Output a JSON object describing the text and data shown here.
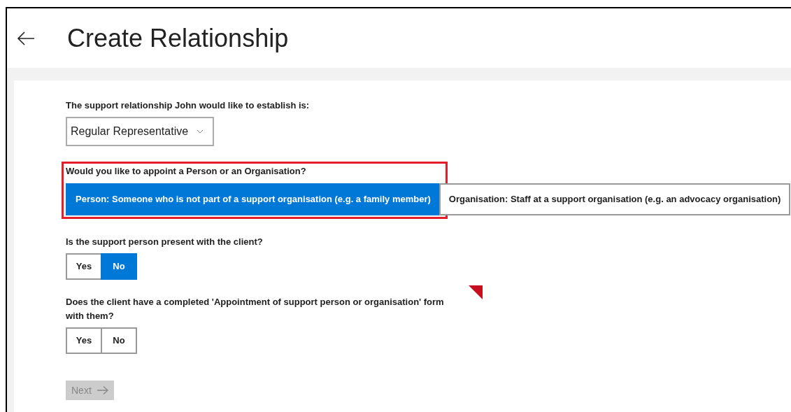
{
  "header": {
    "title": "Create Relationship"
  },
  "relationship": {
    "label": "The support relationship John would like to establish is:",
    "value": "Regular Representative"
  },
  "appoint": {
    "label": "Would you like to appoint a Person or an Organisation?",
    "highlighted": true,
    "options": [
      {
        "label": "Person: Someone who is not part of a support organisation (e.g. a family member)",
        "selected": true
      },
      {
        "label": "Organisation: Staff at a support organisation (e.g. an advocacy organisation)",
        "selected": false
      }
    ]
  },
  "questions": [
    {
      "label": "Is the support person present with the client?",
      "flagged": false,
      "options": [
        {
          "label": "Yes",
          "selected": false
        },
        {
          "label": "No",
          "selected": true
        }
      ]
    },
    {
      "label": "Does the client have a completed 'Appointment of support person or organisation' form with them?",
      "flagged": true,
      "options": [
        {
          "label": "Yes",
          "selected": false
        },
        {
          "label": "No",
          "selected": false
        }
      ]
    }
  ],
  "next": {
    "label": "Next",
    "disabled": true
  }
}
